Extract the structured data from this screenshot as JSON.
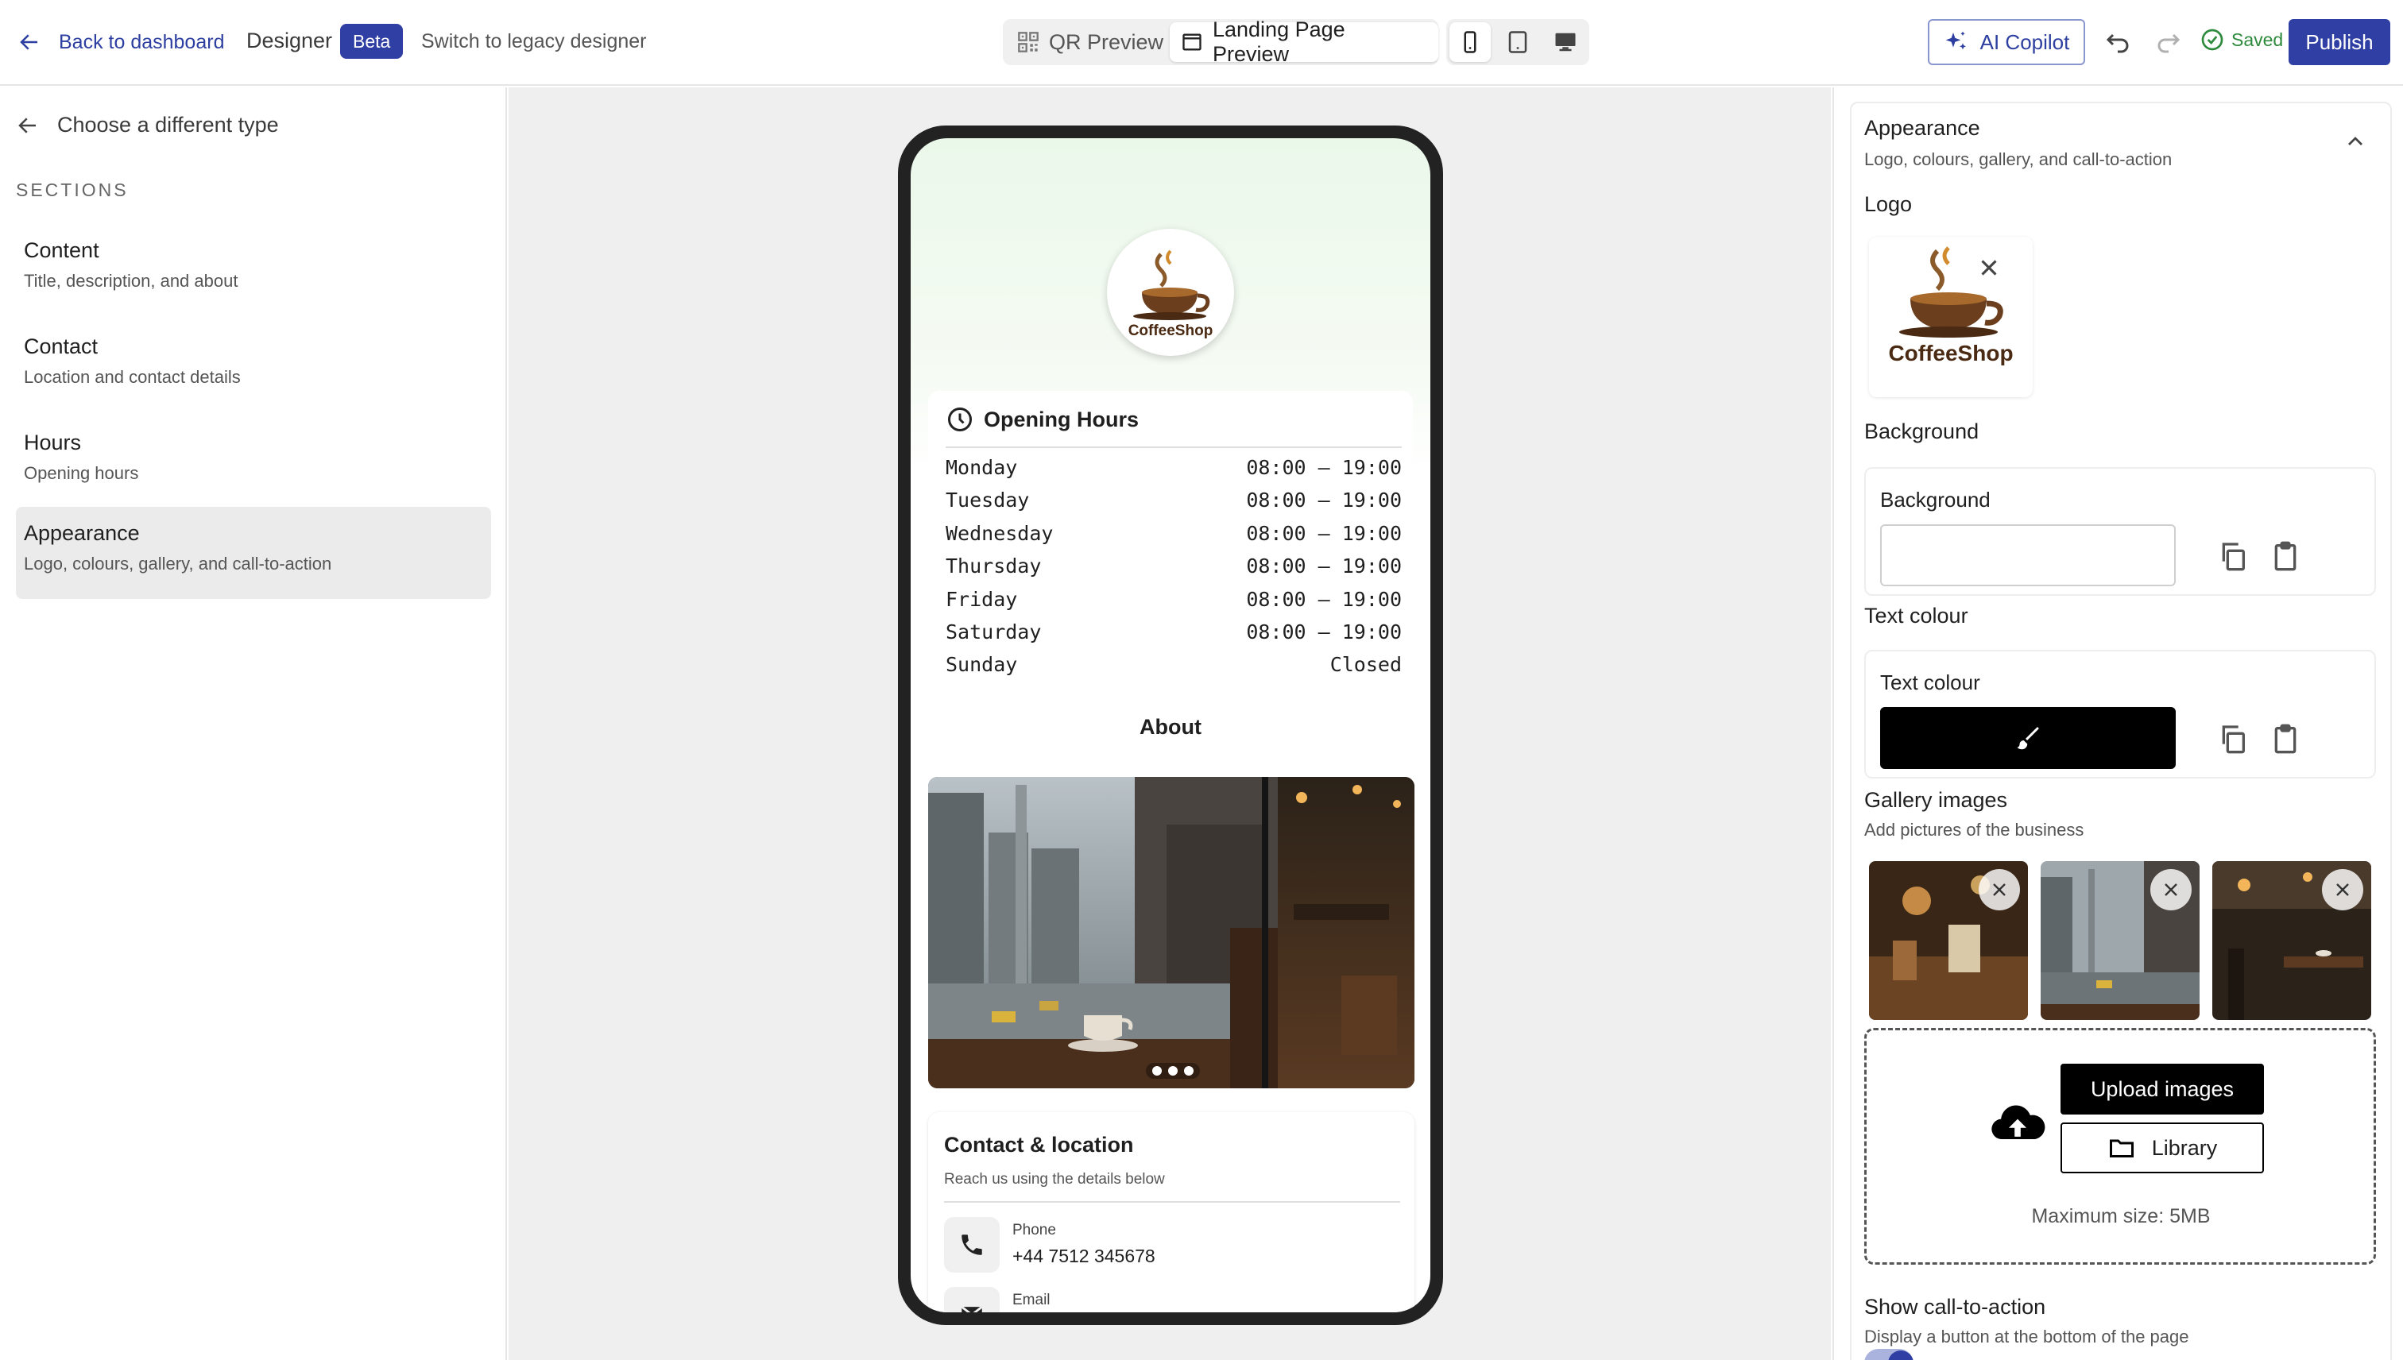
{
  "header": {
    "back_label": "Back to dashboard",
    "designer_label": "Designer",
    "beta_badge": "Beta",
    "legacy_link": "Switch to legacy designer",
    "mode_tabs": [
      {
        "label": "QR Preview",
        "icon": "qr-code-icon"
      },
      {
        "label": "Landing Page Preview",
        "icon": "browser-window-icon"
      }
    ],
    "device_icons": [
      "mobile-icon",
      "tablet-icon",
      "desktop-icon"
    ],
    "copilot_label": "AI Copilot",
    "saved_label": "Saved",
    "publish_label": "Publish"
  },
  "sidebar": {
    "back_label": "Choose a different type",
    "sections_heading": "SECTIONS",
    "items": [
      {
        "title": "Content",
        "subtitle": "Title, description, and about"
      },
      {
        "title": "Contact",
        "subtitle": "Location and contact details"
      },
      {
        "title": "Hours",
        "subtitle": "Opening hours"
      },
      {
        "title": "Appearance",
        "subtitle": "Logo, colours, gallery, and call-to-action"
      }
    ]
  },
  "preview": {
    "logo_text": "CoffeeShop",
    "hours_title": "Opening Hours",
    "hours": [
      {
        "day": "Monday",
        "time": "08:00 – 19:00"
      },
      {
        "day": "Tuesday",
        "time": "08:00 – 19:00"
      },
      {
        "day": "Wednesday",
        "time": "08:00 – 19:00"
      },
      {
        "day": "Thursday",
        "time": "08:00 – 19:00"
      },
      {
        "day": "Friday",
        "time": "08:00 – 19:00"
      },
      {
        "day": "Saturday",
        "time": "08:00 – 19:00"
      },
      {
        "day": "Sunday",
        "time": "Closed"
      }
    ],
    "about_heading": "About",
    "contact_title": "Contact & location",
    "contact_subtitle": "Reach us using the details below",
    "phone_label": "Phone",
    "phone_value": "+44 7512 345678",
    "email_label": "Email"
  },
  "panel": {
    "title": "Appearance",
    "subtitle": "Logo, colours, gallery, and call-to-action",
    "logo_label": "Logo",
    "logo_text": "CoffeeShop",
    "background_section": "Background",
    "background_field_label": "Background",
    "text_colour_section": "Text colour",
    "text_colour_field_label": "Text colour",
    "gallery_label": "Gallery images",
    "gallery_help": "Add pictures of the business",
    "upload_button": "Upload images",
    "library_button": "Library",
    "max_size": "Maximum size: 5MB",
    "cta_label": "Show call-to-action",
    "cta_help": "Display a button at the bottom of the page",
    "cta_enabled": true
  },
  "colors": {
    "accent": "#2f3fa3",
    "background_swatch": "#ffffff",
    "text_swatch": "#000000",
    "saved_green": "#2e8a3c"
  }
}
